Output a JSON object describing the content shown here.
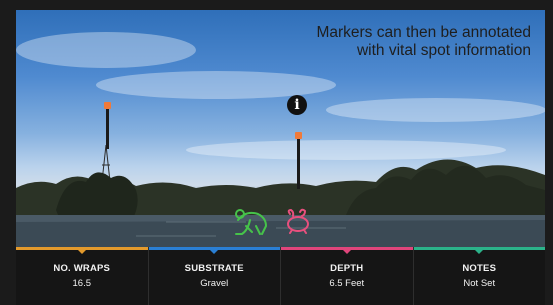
{
  "caption": {
    "line1": "Markers can then be annotated",
    "line2": "with vital spot information"
  },
  "icons": {
    "info": "info-icon",
    "frog": "frog-icon",
    "crayfish": "crayfish-icon"
  },
  "info_glyph": "i",
  "tabs": [
    {
      "label": "NO. WRAPS",
      "value": "16.5",
      "color": "#e39a2c"
    },
    {
      "label": "SUBSTRATE",
      "value": "Gravel",
      "color": "#2a7fd4"
    },
    {
      "label": "DEPTH",
      "value": "6.5 Feet",
      "color": "#e0457b"
    },
    {
      "label": "NOTES",
      "value": "Not Set",
      "color": "#2bb38a"
    }
  ],
  "colors": {
    "marker_cap": "#f07a3a",
    "frog": "#46c34a",
    "crayfish": "#e8507e"
  }
}
